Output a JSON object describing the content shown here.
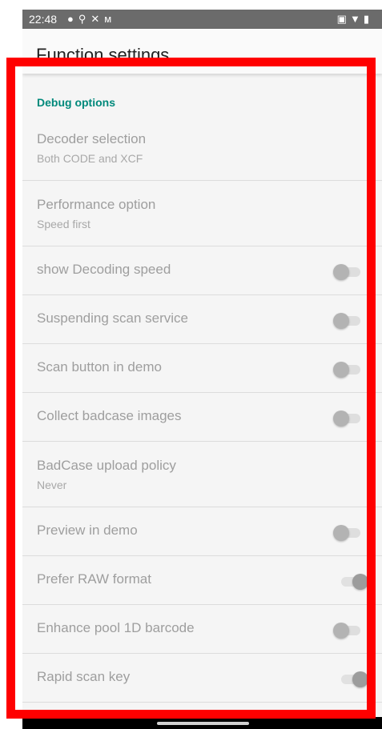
{
  "status_bar": {
    "time": "22:48",
    "left_icons": [
      "check-circle-icon",
      "location-pin-icon",
      "tools-icon",
      "m-logo-icon"
    ],
    "right_icons": [
      "cast-icon",
      "wifi-icon",
      "battery-icon"
    ]
  },
  "app_bar": {
    "title": "Function settings"
  },
  "category": {
    "title": "Debug options",
    "color": "#00897b"
  },
  "preferences": [
    {
      "title": "Decoder selection",
      "summary": "Both CODE and XCF"
    },
    {
      "title": "Performance option",
      "summary": "Speed first"
    },
    {
      "title": "show Decoding speed",
      "switch_on": false
    },
    {
      "title": "Suspending scan service",
      "switch_on": false
    },
    {
      "title": "Scan button in demo",
      "switch_on": false
    },
    {
      "title": "Collect badcase images",
      "switch_on": false
    },
    {
      "title": "BadCase upload policy",
      "summary": "Never"
    },
    {
      "title": "Preview in demo",
      "switch_on": false
    },
    {
      "title": "Prefer RAW format",
      "switch_on": true
    },
    {
      "title": "Enhance pool 1D barcode",
      "switch_on": false
    },
    {
      "title": "Rapid scan key",
      "switch_on": true
    }
  ],
  "highlight_color": "#ff0000"
}
